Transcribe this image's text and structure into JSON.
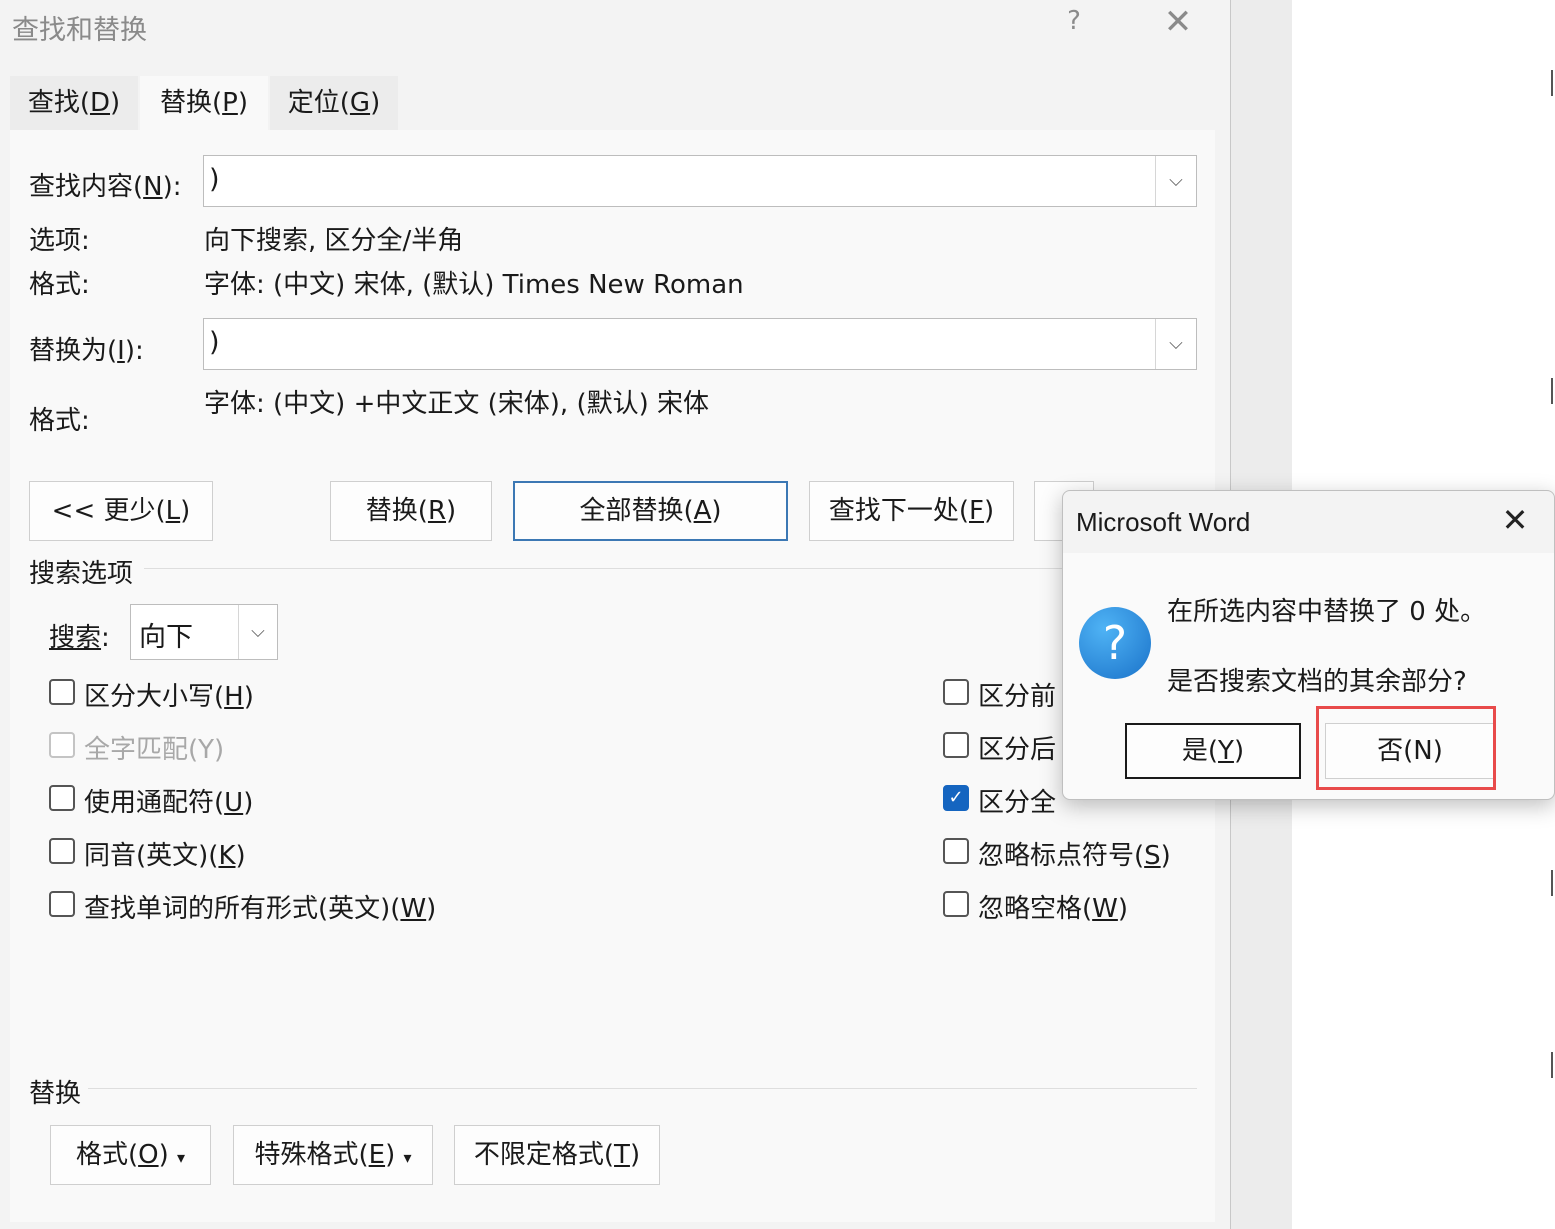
{
  "dialog": {
    "title": "查找和替换",
    "help": "?",
    "close": "✕",
    "tabs": [
      {
        "label": "查找(",
        "key": "D",
        "end": ")"
      },
      {
        "label": "替换(",
        "key": "P",
        "end": ")"
      },
      {
        "label": "定位(",
        "key": "G",
        "end": ")"
      }
    ],
    "find_label": "查找内容(",
    "find_key": "N",
    "find_end": "):",
    "find_value": ")",
    "options_label": "选项:",
    "options_value": "向下搜索, 区分全/半角",
    "format_label": "格式:",
    "find_format": "字体: (中文) 宋体, (默认) Times New Roman",
    "replace_label": "替换为(",
    "replace_key": "I",
    "replace_end": "):",
    "replace_value": ")",
    "replace_format": "字体: (中文) +中文正文 (宋体), (默认) 宋体",
    "dropdown_glyph": "⌵",
    "buttons": {
      "less": "<< 更少(",
      "less_key": "L",
      "replace": "替换(",
      "replace_key": "R",
      "replace_all": "全部替换(",
      "replace_all_key": "A",
      "find_next": "查找下一处(",
      "find_next_key": "F",
      "close_paren": ")"
    },
    "search_options_title": "搜索选项",
    "search_label": "搜索",
    "search_colon": ":",
    "search_direction": "向下",
    "checkboxes_left": [
      {
        "pre": "区分大小写(",
        "key": "H",
        "post": ")"
      },
      {
        "pre": "全字匹配(Y)",
        "key": "",
        "post": ""
      },
      {
        "pre": "使用通配符(",
        "key": "U",
        "post": ")"
      },
      {
        "pre": "同音(英文)(",
        "key": "K",
        "post": ")"
      },
      {
        "pre": "查找单词的所有形式(英文)(",
        "key": "W",
        "post": ")"
      }
    ],
    "checkboxes_right": [
      {
        "pre": "区分前",
        "key": "",
        "post": ""
      },
      {
        "pre": "区分后",
        "key": "",
        "post": ""
      },
      {
        "pre": "区分全",
        "key": "",
        "post": ""
      },
      {
        "pre": "忽略标点符号(",
        "key": "S",
        "post": ")"
      },
      {
        "pre": "忽略空格(",
        "key": "W",
        "post": ")"
      }
    ],
    "check_mark": "✓",
    "replace_section_title": "替换",
    "format_button": "格式(",
    "format_button_key": "O",
    "special_button": "特殊格式(",
    "special_button_key": "E",
    "noformat_button": "不限定格式(",
    "noformat_button_key": "T",
    "menu_arrow": "▾"
  },
  "message_box": {
    "title": "Microsoft Word",
    "close": "✕",
    "icon": "?",
    "line1": "在所选内容中替换了 0 处。",
    "line2": "是否搜索文档的其余部分?",
    "yes": "是(",
    "yes_key": "Y",
    "no": "否(N)",
    "close_paren": ")"
  },
  "colors": {
    "accent": "#1565c0",
    "highlight": "#e84a4a"
  }
}
